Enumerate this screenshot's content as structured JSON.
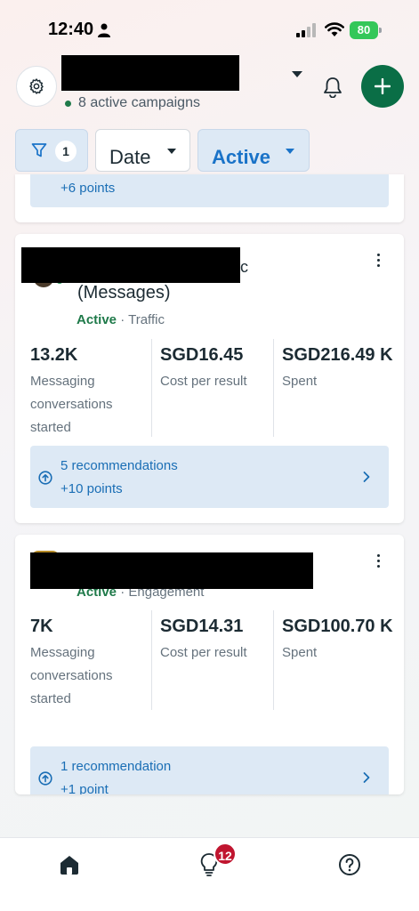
{
  "status_bar": {
    "time": "12:40",
    "battery": "80"
  },
  "header": {
    "campaign_count": "8 active campaigns",
    "icons": [
      "gear-icon",
      "chevron-down-icon",
      "bell-icon",
      "plus-icon"
    ]
  },
  "filters": {
    "filter_count": "1",
    "date_label": "Date",
    "status_label": "Active"
  },
  "cards": [
    {
      "recommendation": {
        "points": "+6 points"
      }
    },
    {
      "name_tail": "c",
      "subtitle": "(Messages)",
      "status": "Active",
      "objective": "Traffic",
      "metrics": [
        {
          "value": "13.2K",
          "label": "Messaging conversations started"
        },
        {
          "value": "SGD16.45",
          "label": "Cost per result"
        },
        {
          "value": "SGD216.49 K",
          "label": "Spent"
        }
      ],
      "recommendation": {
        "title": "5 recommendations",
        "points": "+10 points"
      }
    },
    {
      "status": "Active",
      "objective": "Engagement",
      "metrics": [
        {
          "value": "7K",
          "label": "Messaging conversations started"
        },
        {
          "value": "SGD14.31",
          "label": "Cost per result"
        },
        {
          "value": "SGD100.70 K",
          "label": "Spent"
        }
      ],
      "recommendation": {
        "title": "1 recommendation",
        "points": "+1 point"
      }
    }
  ],
  "bottom_nav": {
    "badge": "12",
    "icons": [
      "home-icon",
      "lightbulb-icon",
      "help-icon"
    ]
  },
  "colors": {
    "accent_blue": "#1a73c8",
    "active_green": "#1f7a4a",
    "add_button_green": "#0a6e46",
    "badge_red": "#c0152f",
    "recommendation_bg": "#dde9f5"
  }
}
